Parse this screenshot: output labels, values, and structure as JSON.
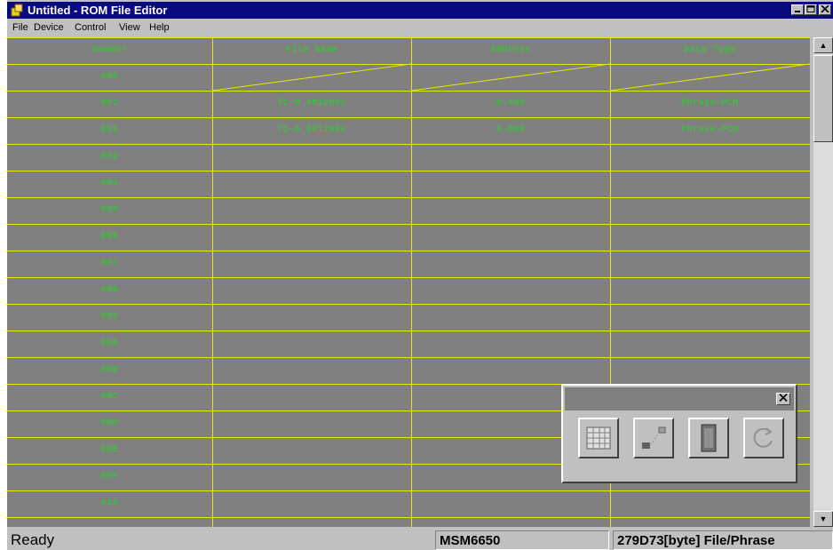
{
  "window": {
    "title": "Untitled - ROM File Editor"
  },
  "title_buttons": [
    "minimize-icon",
    "maximize-icon",
    "close-icon"
  ],
  "menu": [
    "File",
    "Device",
    "Control",
    "View",
    "Help"
  ],
  "table": {
    "headers": [
      "Number",
      "File Name",
      "Address",
      "Data Type"
    ],
    "rows": [
      [
        "000",
        "",
        "",
        ""
      ],
      [
        "001",
        "T1-0_461200c",
        "0-400",
        "Phrase-PCM"
      ],
      [
        "002",
        "T1-0_501200c",
        "0-800",
        "Phrase-PCM"
      ],
      [
        "003",
        "",
        "",
        ""
      ],
      [
        "004",
        "",
        "",
        ""
      ],
      [
        "005",
        "",
        "",
        ""
      ],
      [
        "006",
        "",
        "",
        ""
      ],
      [
        "007",
        "",
        "",
        ""
      ],
      [
        "008",
        "",
        "",
        ""
      ],
      [
        "009",
        "",
        "",
        ""
      ],
      [
        "00A",
        "",
        "",
        ""
      ],
      [
        "00B",
        "",
        "",
        ""
      ],
      [
        "00C",
        "",
        "",
        ""
      ],
      [
        "00D",
        "",
        "",
        ""
      ],
      [
        "00E",
        "",
        "",
        ""
      ],
      [
        "00F",
        "",
        "",
        ""
      ],
      [
        "010",
        "",
        "",
        ""
      ]
    ]
  },
  "status": {
    "message": "Ready",
    "device": "MSM6650",
    "size": "279D73[byte]",
    "mode": "File/Phrase"
  },
  "palette": {
    "buttons": [
      "table-icon",
      "phrase-icon",
      "device-icon",
      "refresh-icon"
    ]
  },
  "colors": {
    "title_bar": "#0a0a80",
    "grid_background": "#808080",
    "grid_lines": "#e8e800",
    "cell_text": "#22d822",
    "chrome": "#c0c0c0"
  }
}
